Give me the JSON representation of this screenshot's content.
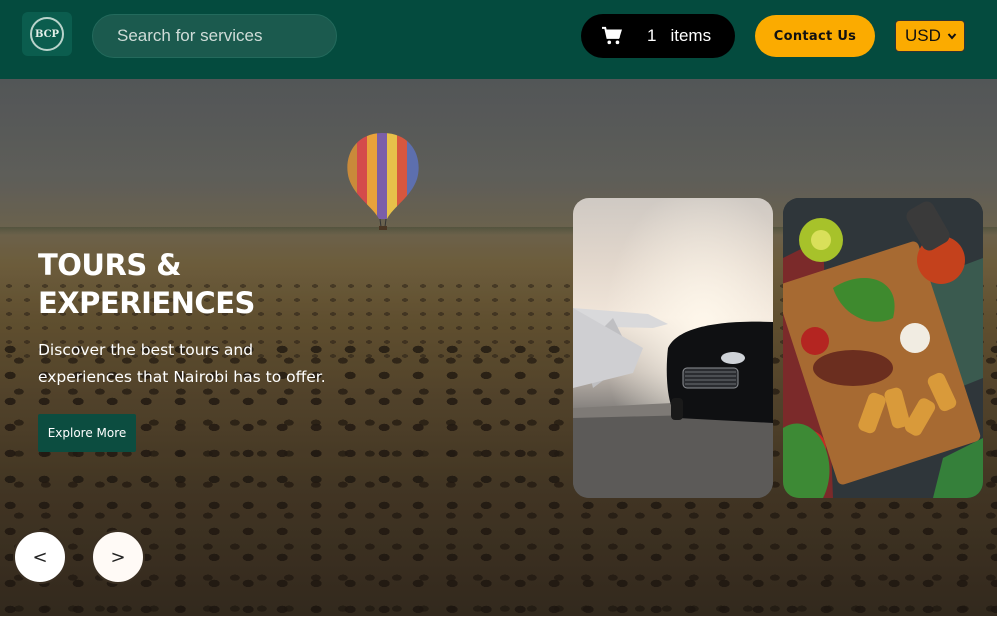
{
  "header": {
    "logo_text": "BCP",
    "search_placeholder": "Search for services",
    "cart": {
      "count": "1",
      "label": "items",
      "icon": "cart-icon"
    },
    "contact_label": "Contact Us",
    "currency": "USD",
    "colors": {
      "header_bg": "#044b3e",
      "accent": "#fbab00"
    }
  },
  "hero": {
    "title_line1": "TOURS &",
    "title_line2": "EXPERIENCES",
    "subtitle_line1": "Discover the best tours and",
    "subtitle_line2": "experiences that Nairobi has to offer.",
    "explore_label": "Explore More",
    "prev_label": "<",
    "next_label": ">",
    "cards": [
      {
        "name": "private-jet-car-image"
      },
      {
        "name": "food-platter-image"
      }
    ]
  }
}
